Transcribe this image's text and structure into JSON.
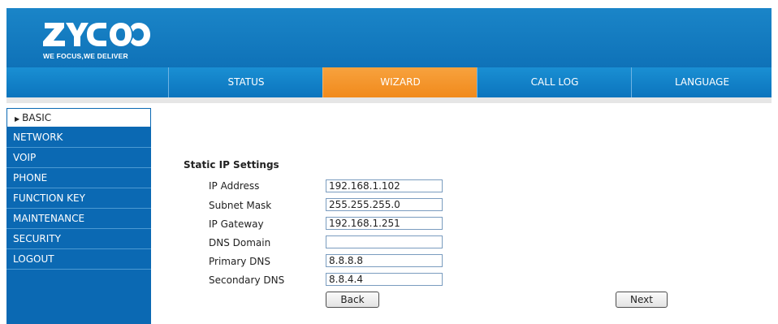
{
  "brand": {
    "logo_text": "ZYCOO",
    "tagline": "WE FOCUS,WE DELIVER"
  },
  "nav": {
    "tabs": [
      {
        "label": "STATUS"
      },
      {
        "label": "WIZARD",
        "active": true
      },
      {
        "label": "CALL LOG"
      },
      {
        "label": "LANGUAGE"
      }
    ]
  },
  "sidebar": {
    "items": [
      {
        "label": "BASIC",
        "active": true
      },
      {
        "label": "NETWORK"
      },
      {
        "label": "VOIP"
      },
      {
        "label": "PHONE"
      },
      {
        "label": "FUNCTION KEY"
      },
      {
        "label": "MAINTENANCE"
      },
      {
        "label": "SECURITY"
      },
      {
        "label": "LOGOUT"
      }
    ]
  },
  "static_ip": {
    "title": "Static IP Settings",
    "fields": [
      {
        "label": "IP Address",
        "value": "192.168.1.102"
      },
      {
        "label": "Subnet Mask",
        "value": "255.255.255.0"
      },
      {
        "label": "IP Gateway",
        "value": "192.168.1.251"
      },
      {
        "label": "DNS Domain",
        "value": ""
      },
      {
        "label": "Primary DNS",
        "value": "8.8.8.8"
      },
      {
        "label": "Secondary DNS",
        "value": "8.8.4.4"
      }
    ]
  },
  "buttons": {
    "back": "Back",
    "next": "Next"
  },
  "colors": {
    "header_blue": "#1a85c8",
    "active_tab_orange": "#f18a1c",
    "sidebar_blue": "#0b69b3"
  }
}
